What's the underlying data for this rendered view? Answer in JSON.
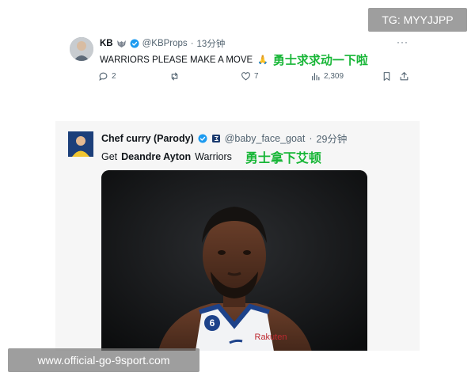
{
  "tweet1": {
    "name": "KB",
    "handle": "@KBProps",
    "separator": "·",
    "time": "13分钟",
    "text": "WARRIORS PLEASE MAKE A MOVE",
    "emoji": "🙏",
    "caption": "勇士求求动一下啦",
    "more": "···",
    "replies": "2",
    "retweets": "",
    "likes": "7",
    "views": "2,309"
  },
  "tweet2": {
    "name": "Chef curry (Parody)",
    "handle": "@baby_face_goat",
    "separator": "·",
    "time": "29分钟",
    "text_prefix": "Get",
    "text_bold": "Deandre Ayton",
    "text_suffix": "Warriors",
    "caption": "勇士拿下艾顿",
    "jersey_number": "6",
    "jersey_sponsor": "Rakuten"
  },
  "watermarks": {
    "tg": "TG: MYYJJPP",
    "url": "www.official-go-9sport.com"
  },
  "colors": {
    "caption_green": "#18b637",
    "verified_blue": "#1d9bf0",
    "muted": "#536471"
  },
  "icons": {
    "reply": "reply-icon",
    "retweet": "retweet-icon",
    "like": "heart-icon",
    "views": "views-icon",
    "bookmark": "bookmark-icon",
    "share": "share-icon"
  }
}
